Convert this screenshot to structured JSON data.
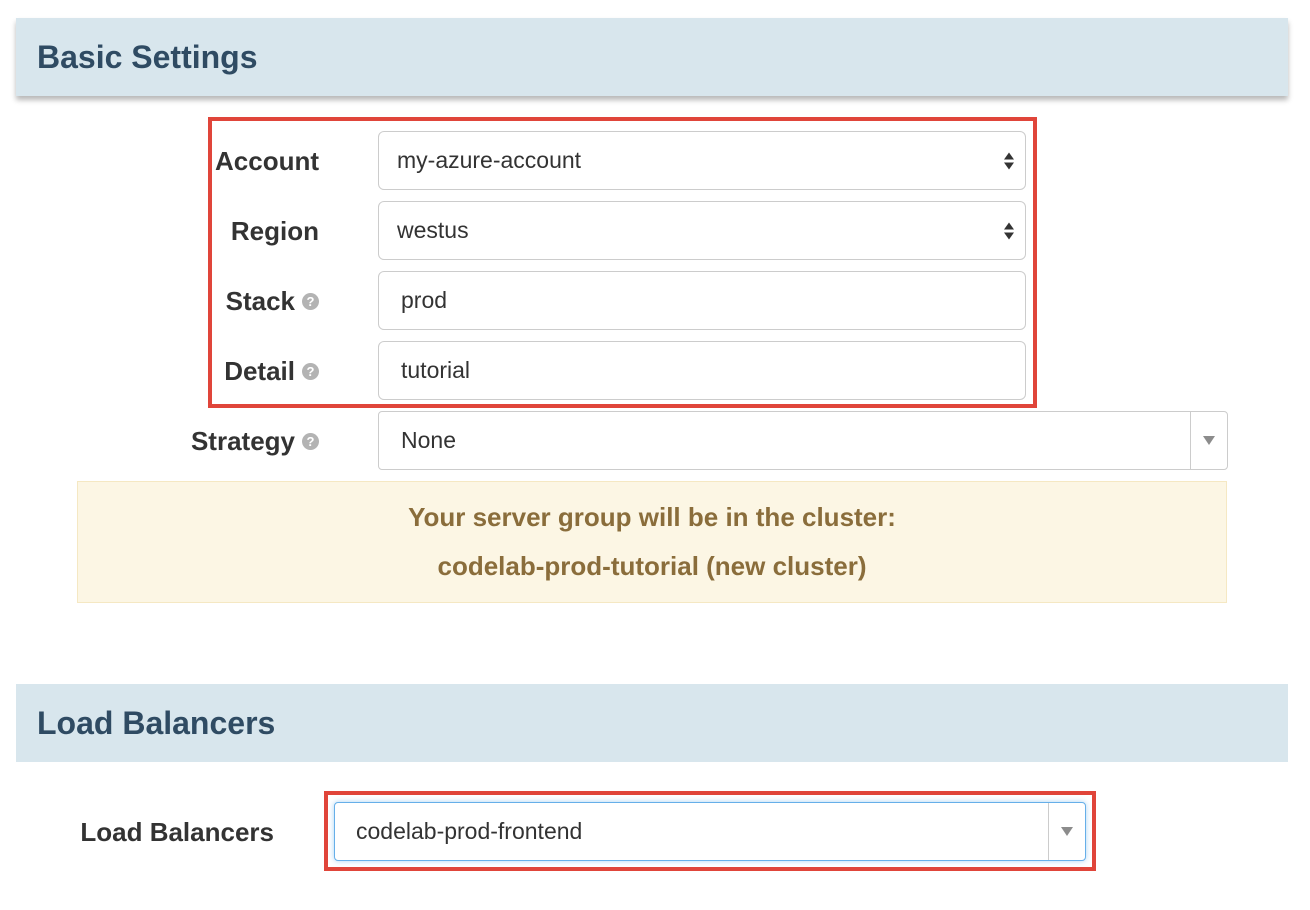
{
  "basic_settings": {
    "title": "Basic Settings",
    "account": {
      "label": "Account",
      "value": "my-azure-account"
    },
    "region": {
      "label": "Region",
      "value": "westus"
    },
    "stack": {
      "label": "Stack",
      "value": "prod"
    },
    "detail": {
      "label": "Detail",
      "value": "tutorial"
    },
    "strategy": {
      "label": "Strategy",
      "value": "None"
    },
    "help_glyph": "?",
    "cluster_notice": {
      "line1": "Your server group will be in the cluster:",
      "line2": "codelab-prod-tutorial (new cluster)"
    }
  },
  "load_balancers_section": {
    "title": "Load Balancers",
    "field_label": "Load Balancers",
    "value": "codelab-prod-frontend"
  },
  "colors": {
    "header_bg": "#d8e6ed",
    "header_text": "#2f4b63",
    "highlight_border": "#e0453a",
    "notice_bg": "#fcf6e4",
    "notice_text": "#8a6d3b",
    "focus_border": "#66afe9"
  },
  "icons": {
    "help": "help-circle-icon",
    "select_arrows": "up-down-arrows-icon",
    "dropdown": "caret-down-icon"
  }
}
